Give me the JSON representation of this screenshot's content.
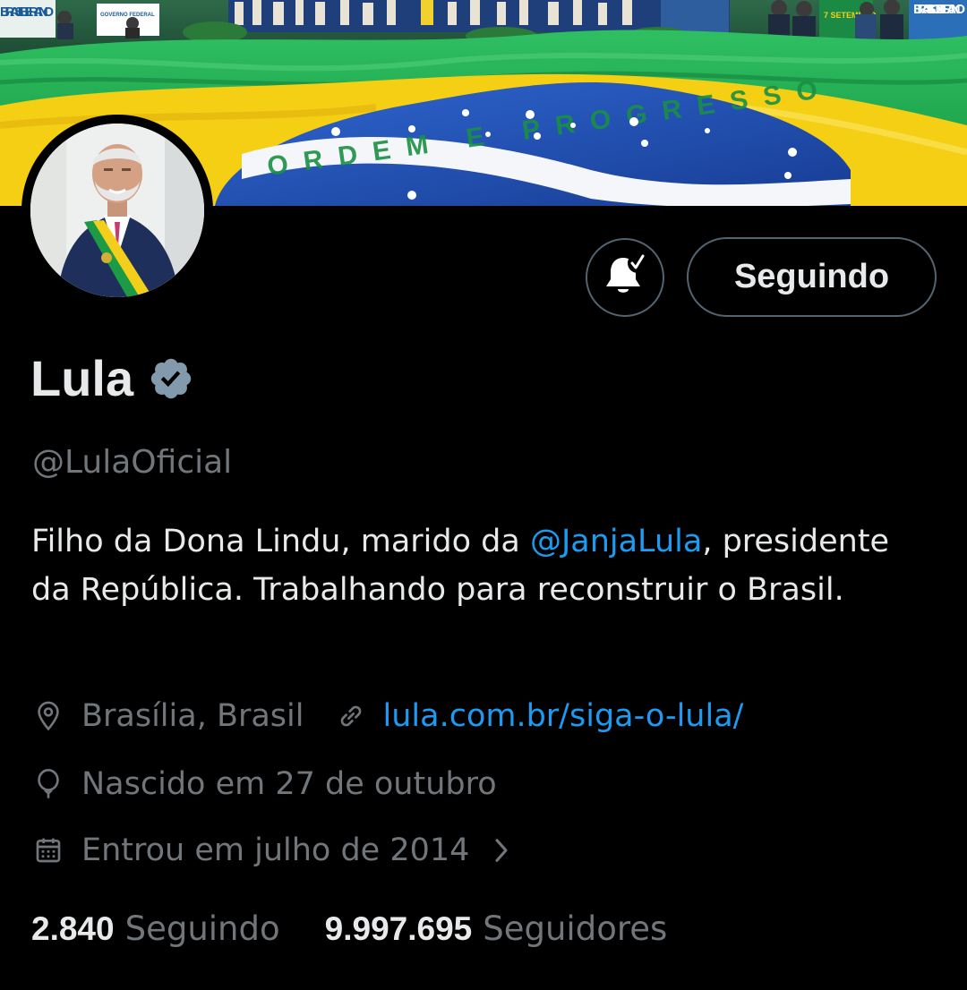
{
  "banner": {
    "flag_motto": "ORDEM E PROGRESSO",
    "sign_left": "BRASIL BERANO",
    "sign_right": "BRASIL SOBERANO",
    "sign_gov": "GOVERNO FEDERAL",
    "sign_anniv": "7 SETEMBRO",
    "colors": {
      "green": "#1aa64b",
      "yellow": "#f5cf17",
      "blue": "#1f4fb6"
    }
  },
  "profile": {
    "display_name": "Lula",
    "handle": "@LulaOficial",
    "verified": true,
    "bio": {
      "part1": "Filho da Dona Lindu, marido da ",
      "mention": "@JanjaLula",
      "part2": ", presidente da República. Trabalhando para reconstruir o Brasil."
    },
    "location": "Brasília, Brasil",
    "website": "lula.com.br/siga-o-lula/",
    "birthday": "Nascido em 27 de outubro",
    "joined": "Entrou em julho de 2014"
  },
  "actions": {
    "following_label": "Seguindo",
    "notification_icon": "bell-check-icon"
  },
  "stats": {
    "following_count": "2.840",
    "following_label": "Seguindo",
    "followers_count": "9.997.695",
    "followers_label": "Seguidores"
  },
  "colors": {
    "background": "#000000",
    "text_primary": "#e7e9ea",
    "text_secondary": "#71767b",
    "link": "#1d9bf0",
    "badge": "#829aab",
    "border": "#536471"
  }
}
